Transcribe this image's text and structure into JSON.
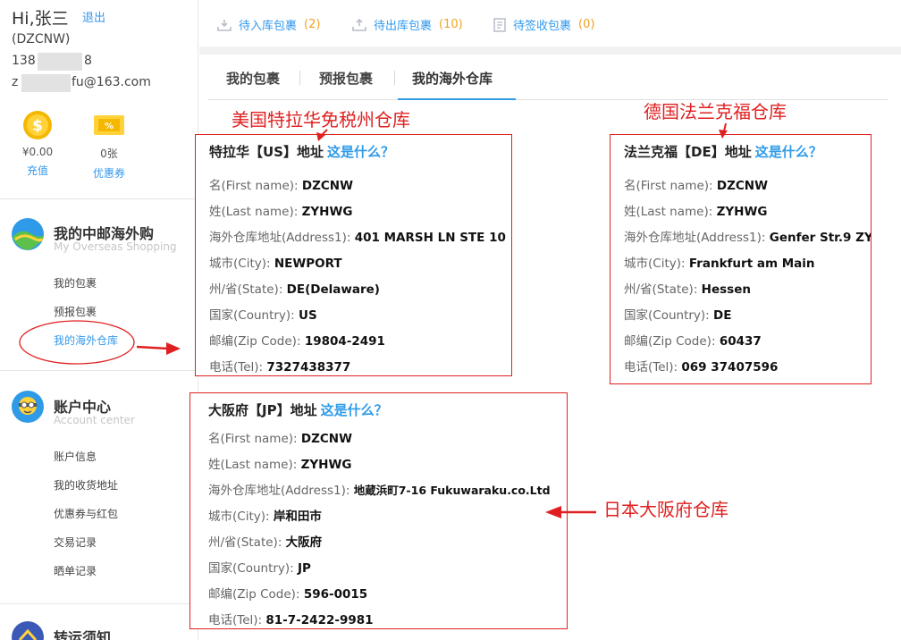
{
  "sidebar": {
    "greeting": "Hi,张三",
    "logout": "退出",
    "user_id": "(DZCNW)",
    "phone_start": "138",
    "phone_end": "8",
    "email_start": "z",
    "email_end": "fu@163.com",
    "wallet": [
      {
        "value": "¥0.00",
        "link": "充值",
        "icon": "coin-icon"
      },
      {
        "value": "0张",
        "link": "优惠券",
        "icon": "coupon-ticket-icon"
      }
    ],
    "overseas": {
      "title": "我的中邮海外购",
      "subtitle": "My Overseas Shopping",
      "items": [
        "我的包裹",
        "预报包裹",
        "我的海外仓库"
      ]
    },
    "account": {
      "title": "账户中心",
      "subtitle": "Account center",
      "items": [
        "账户信息",
        "我的收货地址",
        "优惠券与红包",
        "交易记录",
        "晒单记录"
      ]
    },
    "transfer": {
      "title": "转运须知"
    }
  },
  "topbar": [
    {
      "label": "待入库包裹",
      "count": "(2)",
      "icon": "inbox-icon"
    },
    {
      "label": "待出库包裹",
      "count": "(10)",
      "icon": "outbox-icon"
    },
    {
      "label": "待签收包裹",
      "count": "(0)",
      "icon": "document-icon"
    }
  ],
  "tabs": [
    "我的包裹",
    "预报包裹",
    "我的海外仓库"
  ],
  "warehouses": {
    "us": {
      "title": "特拉华【US】地址",
      "what": "这是什么？",
      "rows": [
        {
          "k": "名(First name):",
          "v": "DZCNW"
        },
        {
          "k": "姓(Last name):",
          "v": "ZYHWG"
        },
        {
          "k": "海外仓库地址(Address1):",
          "v": "401 MARSH LN STE 10"
        },
        {
          "k": "城市(City):",
          "v": "NEWPORT"
        },
        {
          "k": "州/省(State):",
          "v": "DE(Delaware)"
        },
        {
          "k": "国家(Country):",
          "v": "US"
        },
        {
          "k": "邮编(Zip Code):",
          "v": "19804-2491"
        },
        {
          "k": "电话(Tel):",
          "v": "7327438377"
        }
      ]
    },
    "de": {
      "title": "法兰克福【DE】地址",
      "what": "这是什么？",
      "rows": [
        {
          "k": "名(First name):",
          "v": "DZCNW"
        },
        {
          "k": "姓(Last name):",
          "v": "ZYHWG"
        },
        {
          "k": "海外仓库地址(Address1):",
          "v": "Genfer Str.9 ZY"
        },
        {
          "k": "城市(City):",
          "v": "Frankfurt am Main"
        },
        {
          "k": "州/省(State):",
          "v": "Hessen"
        },
        {
          "k": "国家(Country):",
          "v": "DE"
        },
        {
          "k": "邮编(Zip Code):",
          "v": "60437"
        },
        {
          "k": "电话(Tel):",
          "v": "069 37407596"
        }
      ]
    },
    "jp": {
      "title": "大阪府【JP】地址",
      "what": "这是什么？",
      "rows": [
        {
          "k": "名(First name):",
          "v": "DZCNW"
        },
        {
          "k": "姓(Last name):",
          "v": "ZYHWG"
        },
        {
          "k": "海外仓库地址(Address1):",
          "v": "地蔵浜町7-16 Fukuwaraku.co.Ltd"
        },
        {
          "k": "城市(City):",
          "v": "岸和田市"
        },
        {
          "k": "州/省(State):",
          "v": "大阪府"
        },
        {
          "k": "国家(Country):",
          "v": "JP"
        },
        {
          "k": "邮编(Zip Code):",
          "v": "596-0015"
        },
        {
          "k": "电话(Tel):",
          "v": "81-7-2422-9981"
        }
      ]
    }
  },
  "annotations": {
    "us": "美国特拉华免税州仓库",
    "de": "德国法兰克福仓库",
    "jp": "日本大阪府仓库"
  },
  "colors": {
    "accent": "#2f9be8",
    "annotation": "#e02020",
    "count": "#f0a020"
  }
}
